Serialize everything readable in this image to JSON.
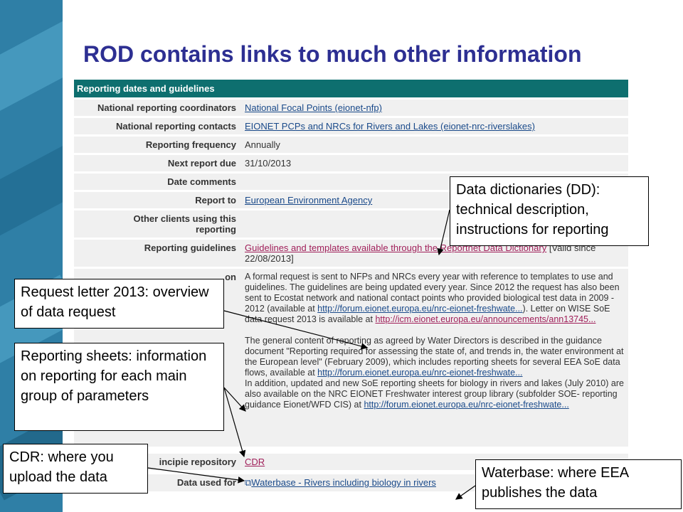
{
  "title": "ROD contains links to much other information",
  "table": {
    "header": "Reporting dates and guidelines",
    "rows": [
      {
        "label": "National reporting coordinators",
        "value": "National Focal Points (eionet-nfp)",
        "link": true
      },
      {
        "label": "National reporting contacts",
        "value": "EIONET PCPs and NRCs for Rivers and Lakes (eionet-nrc-riverslakes)",
        "link": true
      },
      {
        "label": "Reporting frequency",
        "value": "Annually",
        "link": false
      },
      {
        "label": "Next report due",
        "value": "31/10/2013",
        "link": false
      },
      {
        "label": "Date comments",
        "value": "",
        "link": false
      },
      {
        "label": "Report to",
        "value": "European Environment Agency",
        "link": true
      },
      {
        "label": "Other clients using this reporting",
        "value": "",
        "link": false
      }
    ],
    "guidelines": {
      "label": "Reporting guidelines",
      "link": "Guidelines and templates available through the Reportnet Data Dictionary",
      "suffix": " [Valid since 22/08/2013]"
    },
    "extra": {
      "label": "on",
      "p1": "A formal request is sent to NFPs and NRCs every year with reference to templates to use and guidelines. The guidelines are being updated every year. Since 2012 the request has also been sent to Ecostat network and national contact points who provided biological test data in 2009 - 2012 (available at",
      "p1_link": "http://forum.eionet.europa.eu/nrc-eionet-freshwate...",
      "p1_mid": "). Letter on WISE SoE data request 2013 is available at",
      "p1_link2": "http://icm.eionet.europa.eu/announcements/ann13745...",
      "p2": "The general content of reporting as agreed by Water Directors is described in the guidance document \"Reporting required for assessing the state of, and trends in, the water environment at the European level\" (February 2009), which includes reporting sheets for several EEA SoE data flows, available at",
      "p2_link": "http://forum.eionet.europa.eu/nrc-eionet-freshwate...",
      "p3": "In addition, updated and new SoE reporting sheets for biology in rivers and lakes (July 2010) are also available on the NRC EIONET Freshwater interest group library (subfolder SOE- reporting guidance Eionet/WFD CIS) at",
      "p3_link": "http://forum.eionet.europa.eu/nrc-eionet-freshwate..."
    },
    "repository": {
      "label": "incipie repository",
      "value": "CDR"
    },
    "data_used": {
      "label": "Data used for",
      "value": "Waterbase - Rivers including biology in rivers"
    }
  },
  "callouts": {
    "dd": "Data dictionaries (DD): technical description, instructions for reporting",
    "request": "Request letter 2013: overview of data request",
    "sheets": "Reporting sheets: information on reporting for each main group of parameters",
    "cdr": "CDR: where you upload the data",
    "waterbase": "Waterbase: where EEA publishes the data"
  },
  "colors": {
    "title": "#2d2f92",
    "header_bg": "#0e6f6f",
    "link": "#1a4a8a",
    "link_visited": "#a0205a"
  }
}
